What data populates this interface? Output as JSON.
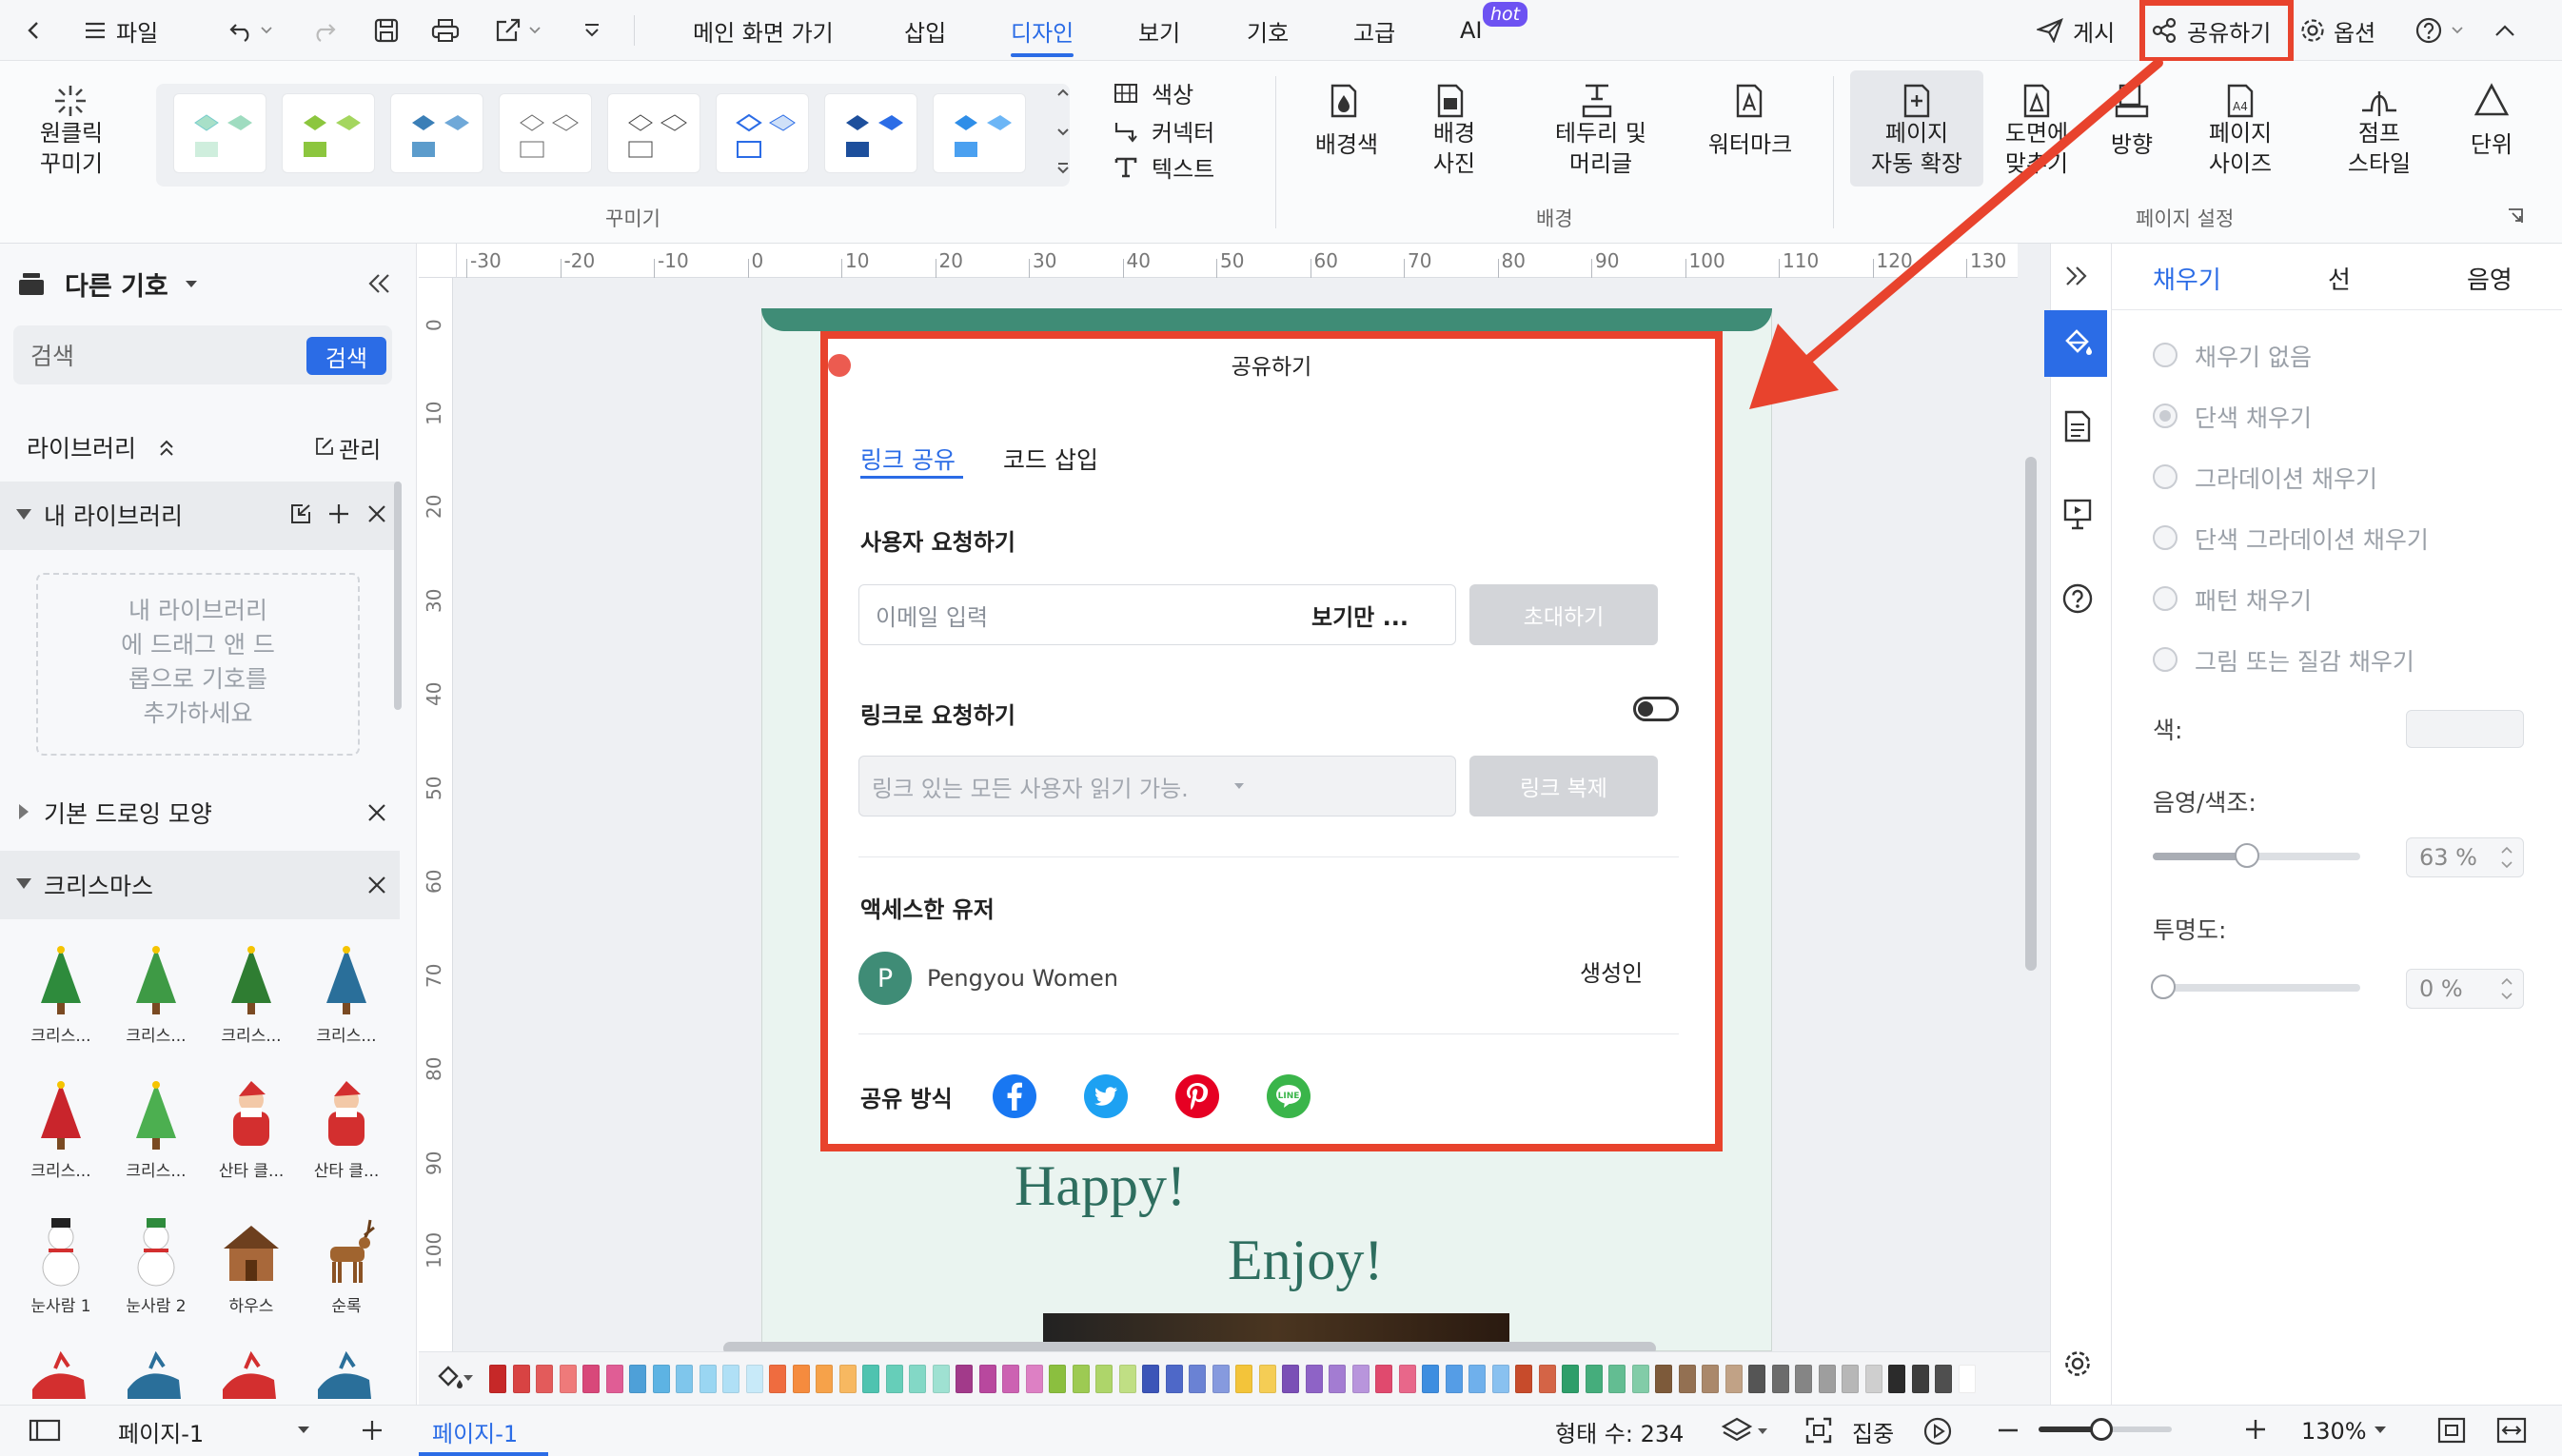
{
  "topbar": {
    "file": "파일",
    "tabs": [
      "메인 화면 가기",
      "삽입",
      "디자인",
      "보기",
      "기호",
      "고급",
      "AI"
    ],
    "ai_badge": "hot",
    "publish": "게시",
    "share": "공유하기",
    "options": "옵션"
  },
  "ribbon": {
    "one_click": "원클릭\n꾸미기",
    "color": "색상",
    "connector": "커넥터",
    "text": "텍스트",
    "decor_group": "꾸미기",
    "bg_color": "배경색",
    "bg_photo": "배경\n사진",
    "border_header": "테두리 및\n머리글",
    "watermark": "워터마크",
    "bg_group": "배경",
    "auto_extend": "페이지\n자동 확장",
    "fit": "도면에\n맞추기",
    "orientation": "방향",
    "page_size": "페이지\n사이즈",
    "jump_style": "점프\n스타일",
    "unit": "단위",
    "page_group": "페이지 설정"
  },
  "left": {
    "title": "다른 기호",
    "search_placeholder": "검색",
    "search_btn": "검색",
    "library": "라이브러리",
    "manage": "관리",
    "my_library": "내 라이브러리",
    "drop_hint": "내 라이브러리\n에 드래그 앤 드\n롭으로 기호를\n추가하세요",
    "basic_shapes": "기본 드로잉 모양",
    "christmas": "크리스마스",
    "symbols": [
      "크리스...",
      "크리스...",
      "크리스...",
      "크리스...",
      "크리스...",
      "크리스...",
      "산타 클...",
      "산타 클...",
      "눈사람 1",
      "눈사람 2",
      "하우스",
      "순록"
    ]
  },
  "ruler": {
    "top": [
      "-30",
      "-20",
      "-10",
      "0",
      "10",
      "20",
      "30",
      "40",
      "50",
      "60",
      "70",
      "80",
      "90",
      "100",
      "110",
      "120",
      "130"
    ],
    "left": [
      "0",
      "10",
      "20",
      "30",
      "40",
      "50",
      "60",
      "70",
      "80",
      "90",
      "100"
    ]
  },
  "canvas": {
    "text1": "Happy!",
    "text2": "Enjoy!"
  },
  "dialog": {
    "title": "공유하기",
    "tab_link": "링크 공유",
    "tab_embed": "코드 삽입",
    "invite_label": "사용자 요청하기",
    "email_placeholder": "이메일 입력",
    "permission": "보기만 ...",
    "invite_btn": "초대하기",
    "link_label": "링크로 요청하기",
    "link_value": "링크 있는 모든 사용자 읽기 가능.",
    "copy_btn": "링크 복제",
    "access_label": "액세스한 유저",
    "user_initial": "P",
    "user_name": "Pengyou Women",
    "user_role": "생성인",
    "share_via": "공유 방식"
  },
  "right": {
    "tabs": [
      "채우기",
      "선",
      "음영"
    ],
    "fills": [
      "채우기 없음",
      "단색 채우기",
      "그라데이션 채우기",
      "단색 그라데이션 채우기",
      "패턴 채우기",
      "그림 또는 질감 채우기"
    ],
    "color_label": "색:",
    "shade_label": "음영/색조:",
    "shade_value": "63 %",
    "alpha_label": "투명도:",
    "alpha_value": "0 %"
  },
  "status": {
    "page_sel": "페이지-1",
    "page_tab": "페이지-1",
    "shape_count": "형태 수: 234",
    "focus": "집중",
    "zoom": "130%"
  },
  "colors": {
    "accent": "#2b6ce6",
    "highlight": "#e8432d",
    "banner": "#3f8c76"
  }
}
